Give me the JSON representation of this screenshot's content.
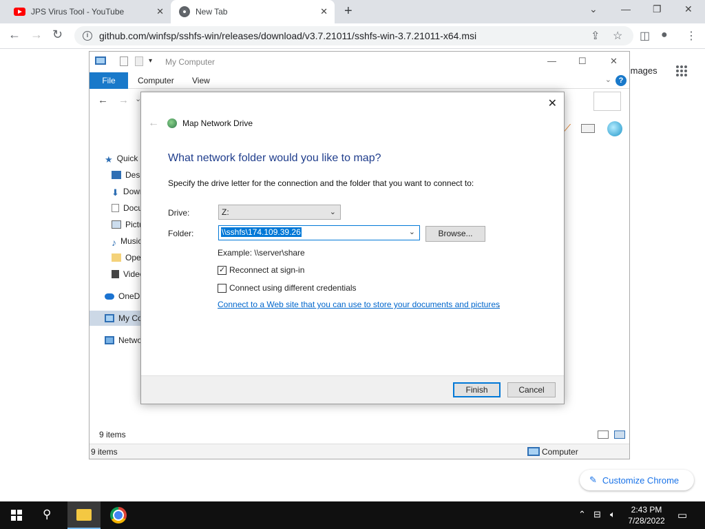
{
  "browser": {
    "tabs": [
      {
        "title": "JPS Virus Tool - YouTube",
        "icon": "youtube-icon"
      },
      {
        "title": "New Tab",
        "icon": "chrome-icon"
      }
    ],
    "url": "github.com/winfsp/sshfs-win/releases/download/v3.7.21011/sshfs-win-3.7.21011-x64.msi",
    "images_link": "Images",
    "customize_label": "Customize Chrome"
  },
  "explorer": {
    "title": "My Computer",
    "ribbon": {
      "file": "File",
      "computer": "Computer",
      "view": "View"
    },
    "sidebar": [
      {
        "label": "Quick access",
        "icon": "star-icon"
      },
      {
        "label": "Desktop",
        "icon": "desktop-icon"
      },
      {
        "label": "Downloads",
        "icon": "download-icon"
      },
      {
        "label": "Documents",
        "icon": "document-icon"
      },
      {
        "label": "Pictures",
        "icon": "pictures-icon"
      },
      {
        "label": "Music",
        "icon": "music-icon"
      },
      {
        "label": "OpenVPN",
        "icon": "folder-icon"
      },
      {
        "label": "Videos",
        "icon": "video-icon"
      },
      {
        "label": "OneDrive",
        "icon": "cloud-icon"
      },
      {
        "label": "My Computer",
        "icon": "computer-icon"
      },
      {
        "label": "Network",
        "icon": "network-icon"
      }
    ],
    "items_count": "9 items",
    "status_left": "9 items",
    "status_right": "Computer"
  },
  "dialog": {
    "title": "Map Network Drive",
    "heading": "What network folder would you like to map?",
    "description": "Specify the drive letter for the connection and the folder that you want to connect to:",
    "drive_label": "Drive:",
    "drive_value": "Z:",
    "folder_label": "Folder:",
    "folder_value": "\\\\sshfs\\174.109.39.26",
    "browse_label": "Browse...",
    "example": "Example: \\\\server\\share",
    "reconnect_label": "Reconnect at sign-in",
    "reconnect_checked": true,
    "credentials_label": "Connect using different credentials",
    "credentials_checked": false,
    "web_link": "Connect to a Web site that you can use to store your documents and pictures",
    "finish_label": "Finish",
    "cancel_label": "Cancel"
  },
  "taskbar": {
    "time": "2:43 PM",
    "date": "7/28/2022"
  }
}
